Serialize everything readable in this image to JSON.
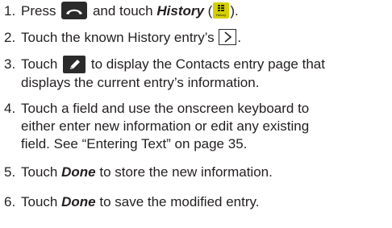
{
  "steps": [
    {
      "number": "1.",
      "text_a": "Press",
      "text_b": "and touch",
      "history_label": "History",
      "paren_open": "(",
      "paren_close": ").",
      "icon_phone": "phone-end-icon",
      "icon_history": "history-icon",
      "history_icon_caption": "History"
    },
    {
      "number": "2.",
      "text_a": "Touch the known History entry’s",
      "text_end": ".",
      "icon_next": "chevron-right-icon"
    },
    {
      "number": "3.",
      "text_a": "Touch",
      "text_b": "to display the Contacts entry page that",
      "line2": "displays the current entry’s information.",
      "icon_edit": "pencil-edit-icon"
    },
    {
      "number": "4.",
      "line1": "Touch a field and use the onscreen keyboard to",
      "line2": "either enter new information or edit any existing",
      "line3": "field. See “Entering Text” on page 35."
    },
    {
      "number": "5.",
      "text_a": "Touch",
      "done_label": "Done",
      "text_b": "to store the new information."
    },
    {
      "number": "6.",
      "text_a": "Touch",
      "done_label": "Done",
      "text_b": "to save the modified entry."
    }
  ]
}
